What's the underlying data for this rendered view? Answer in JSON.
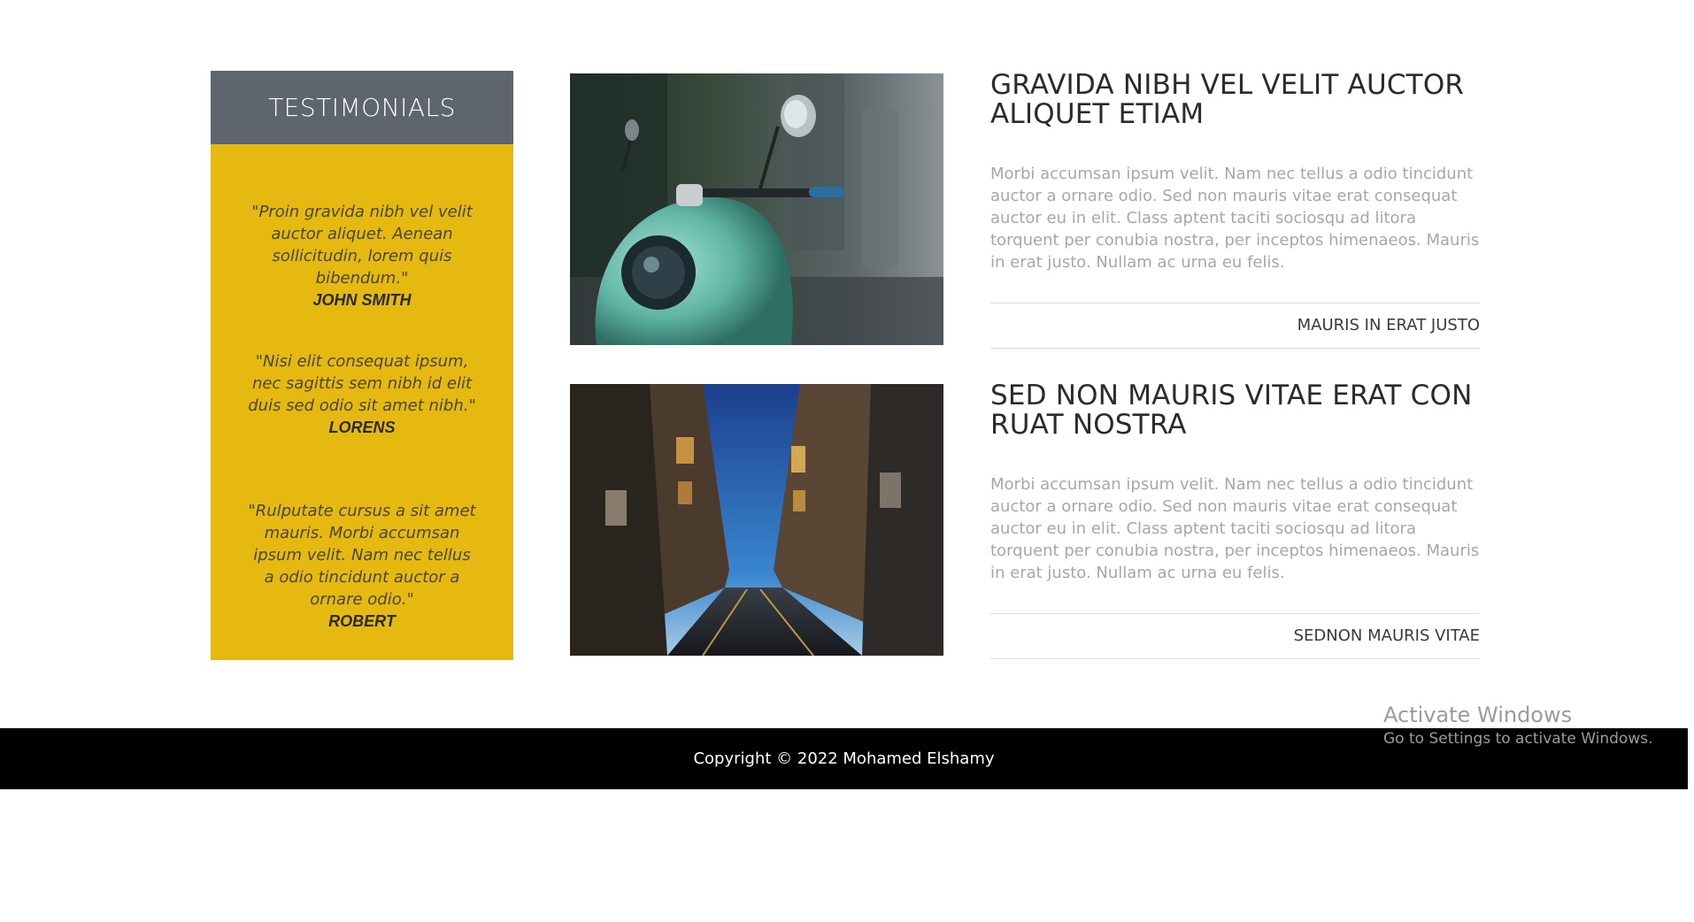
{
  "testimonials": {
    "title": "TESTIMONIALS",
    "items": [
      {
        "quote": "\"Proin gravida nibh vel velit auctor aliquet. Aenean sollicitudin, lorem quis bibendum.\"",
        "author": "JOHN SMITH"
      },
      {
        "quote": "\"Nisi elit consequat ipsum, nec sagittis sem nibh id elit duis sed odio sit amet nibh.\"",
        "author": "LORENS"
      },
      {
        "quote": "\"Rulputate cursus a sit amet mauris. Morbi accumsan ipsum velit. Nam nec tellus a odio tincidunt auctor a ornare odio.\"",
        "author": "ROBERT"
      }
    ],
    "colors": {
      "header_bg": "#5e656e",
      "panel_bg": "#e6b911"
    }
  },
  "articles": [
    {
      "image": "scooter-photo",
      "title": "GRAVIDA NIBH VEL VELIT AUCTOR ALIQUET ETIAM",
      "body": "Morbi accumsan ipsum velit. Nam nec tellus a odio tincidunt auctor a ornare odio. Sed non mauris vitae erat consequat auctor eu in elit. Class aptent taciti sociosqu ad litora torquent per conubia nostra, per inceptos himenaeos. Mauris in erat justo. Nullam ac urna eu felis.",
      "link": "MAURIS IN ERAT JUSTO"
    },
    {
      "image": "street-photo",
      "title": "SED NON MAURIS VITAE ERAT CON RUAT NOSTRA",
      "body": "Morbi accumsan ipsum velit. Nam nec tellus a odio tincidunt auctor a ornare odio. Sed non mauris vitae erat consequat auctor eu in elit. Class aptent taciti sociosqu ad litora torquent per conubia nostra, per inceptos himenaeos. Mauris in erat justo. Nullam ac urna eu felis.",
      "link": "SEDNON MAURIS VITAE"
    }
  ],
  "footer": {
    "copyright": "Copyright © 2022 Mohamed Elshamy"
  },
  "watermark": {
    "line1": "Activate Windows",
    "line2": "Go to Settings to activate Windows."
  }
}
